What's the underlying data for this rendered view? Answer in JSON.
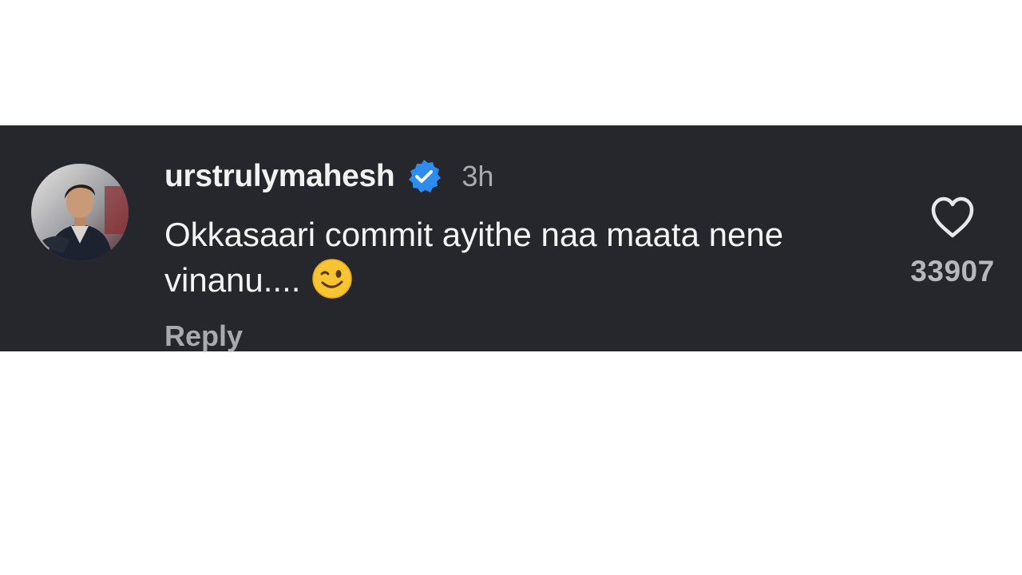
{
  "comment": {
    "username": "urstrulymahesh",
    "verified": true,
    "timestamp": "3h",
    "text": "Okkasaari commit ayithe naa maata nene vinanu....",
    "emoji": "winking-face",
    "reply_label": "Reply",
    "like_count": "33907",
    "like_icon": "heart-outline-icon"
  },
  "colors": {
    "card_background": "#25272c",
    "page_background": "#ffffff",
    "verified_badge": "#2d8cf0",
    "primary_text": "#f4f4f4",
    "secondary_text": "#a8aab0"
  }
}
